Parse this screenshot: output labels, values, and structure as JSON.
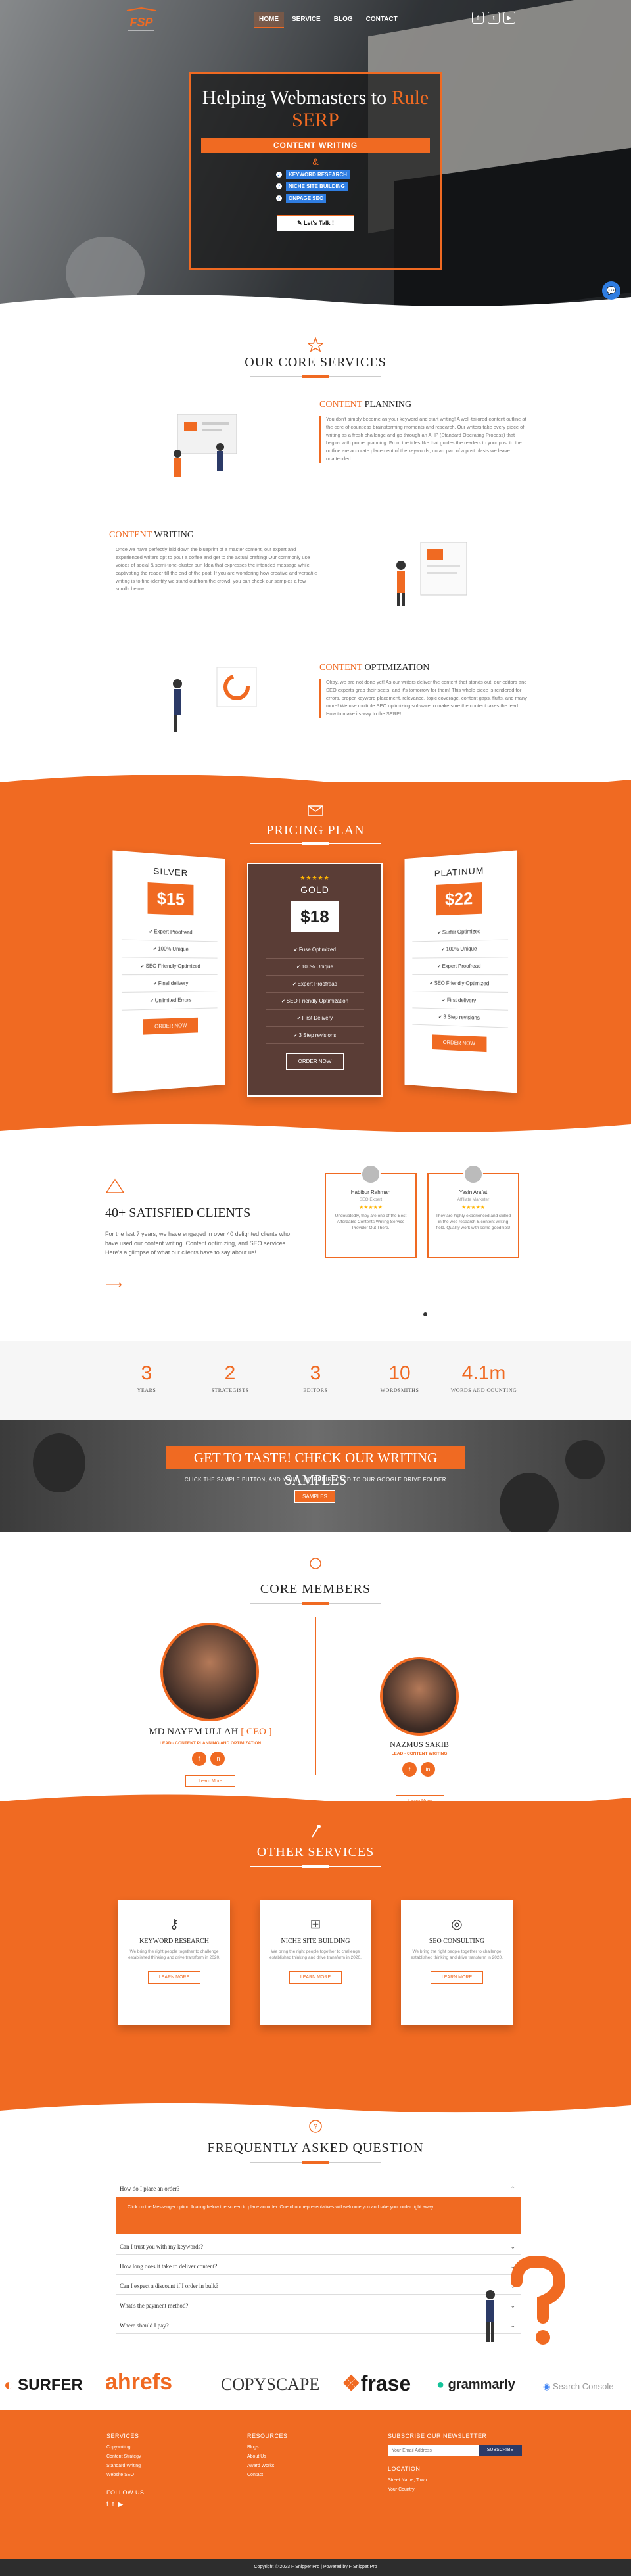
{
  "nav": {
    "logo": "FSP",
    "items": [
      "HOME",
      "SERVICE",
      "BLOG",
      "CONTACT"
    ],
    "social_icons": [
      "facebook-icon",
      "twitter-icon",
      "youtube-icon"
    ]
  },
  "hero": {
    "title_a": "Helping Webmasters to",
    "title_b": "Rule",
    "title_c": "SERP",
    "bar": "CONTENT WRITING",
    "amp": "&",
    "list": [
      "KEYWORD RESEARCH",
      "NICHE SITE BUILDING",
      "ONPAGE SEO"
    ],
    "button": "Let's Talk !"
  },
  "core": {
    "title": "OUR CORE SERVICES",
    "s1_h_o": "CONTENT",
    "s1_h": "PLANNING",
    "s1_p": "You don't simply become an your keyword and start writing! A well-tailored content outline at the core of countless brainstorming moments and research. Our writers take every piece of writing as a fresh challenge and go through an AHP (Standard Operating Process) that begins with proper planning. From the titles like that guides the readers to your post to the outline are accurate placement of the keywords, no art part of a post blasts we leave unattended.",
    "s2_h_o": "CONTENT",
    "s2_h": "WRITING",
    "s2_p": "Once we have perfectly laid down the blueprint of a master content, our expert and experienced writers opt to pour a coffee and get to the actual crafting! Our commonly use voices of social & semi-tone-cluster pun Idea that expresses the intended message while captivating the reader till the end of the post. If you are wondering how creative and versatile writing is to fine-identify we stand out from the crowd, you can check our samples a few scrolls below.",
    "s3_h_o": "CONTENT",
    "s3_h": "OPTIMIZATION",
    "s3_p": "Okay, we are not done yet! As our writers deliver the content that stands out, our editors and SEO experts grab their seats, and it's tomorrow for them! This whole piece is rendered for errors, proper keyword placement, relevance, topic coverage, content gaps, fluffs, and many more! We use multiple SEO optimizing software to make sure the content takes the lead. How to make its way to the SERP!"
  },
  "pricing": {
    "title": "PRICING PLAN",
    "plans": [
      {
        "name": "SILVER",
        "price": "$15",
        "features": [
          "Expert Proofread",
          "100% Unique",
          "SEO Friendly Optimized",
          "Final delivery",
          "Unlimited Errors"
        ],
        "button": "ORDER NOW"
      },
      {
        "name": "GOLD",
        "stars": "★★★★★",
        "price": "$18",
        "features": [
          "Fuse Optimized",
          "100% Unique",
          "Expert Proofread",
          "SEO Friendly Optimization",
          "First Delivery",
          "3 Step revisions"
        ],
        "button": "ORDER NOW"
      },
      {
        "name": "PLATINUM",
        "price": "$22",
        "features": [
          "Surfer Optimized",
          "100% Unique",
          "Expert Proofread",
          "SEO Friendly Optimized",
          "First delivery",
          "3 Step revisions"
        ],
        "button": "ORDER NOW"
      }
    ]
  },
  "clients": {
    "title_n": "40+",
    "title": "SATISFIED CLIENTS",
    "text": "For the last 7 years, we have engaged in over 40 delighted clients who have used our content writing. Content optimizing, and SEO services. Here's a glimpse of what our clients have to say about us!",
    "arrow": "⟶",
    "testimonials": [
      {
        "name": "Habibur Rahman",
        "role": "SEO Expert",
        "stars": "★★★★★",
        "text": "Undoubtedly, they are one of the Best Affordable Contents Writing Service Provider Out There."
      },
      {
        "name": "Yasin Arafat",
        "role": "Affiliate Marketer",
        "stars": "★★★★★",
        "text": "They are highly experienced and skilled in the web research & content writing field. Quality work with some good tips!"
      }
    ]
  },
  "stats": [
    {
      "n": "3",
      "l": "YEARS"
    },
    {
      "n": "2",
      "l": "STRATEGISTS"
    },
    {
      "n": "3",
      "l": "EDITORS"
    },
    {
      "n": "10",
      "l": "WORDSMITHS"
    },
    {
      "n": "4.1m",
      "l": "WORDS AND COUNTING"
    }
  ],
  "samples": {
    "title": "GET TO TASTE! CHECK OUR WRITING SAMPLES",
    "text": "CLICK THE SAMPLE BUTTON, AND YOU'LL BE REDIRECTED TO OUR GOOGLE DRIVE FOLDER",
    "button": "SAMPLES"
  },
  "members": {
    "title": "CORE MEMBERS",
    "m1_name": "MD NAYEM ULLAH",
    "m1_tag": "[ CEO ]",
    "m1_role": "LEAD - CONTENT PLANNING AND OPTIMIZATION",
    "m1_btn": "Learn More",
    "m2_name": "NAZMUS SAKIB",
    "m2_role": "LEAD - CONTENT WRITING",
    "m2_btn": "Learn More"
  },
  "other": {
    "title": "OTHER SERVICES",
    "cards": [
      {
        "icon": "key-icon",
        "title": "KEYWORD RESEARCH",
        "text": "We bring the right people together to challenge established thinking and drive transform in 2020.",
        "button": "LEARN MORE"
      },
      {
        "icon": "sitemap-icon",
        "title": "NICHE SITE BUILDING",
        "text": "We bring the right people together to challenge established thinking and drive transform in 2020.",
        "button": "LEARN MORE"
      },
      {
        "icon": "globe-icon",
        "title": "SEO CONSULTING",
        "text": "We bring the right people together to challenge established thinking and drive transform in 2020.",
        "button": "LEARN MORE"
      }
    ]
  },
  "faq": {
    "title": "FREQUENTLY ASKED QUESTION",
    "q1": "How do I place an order?",
    "a1": "Click on the Messenger option floating below the screen to place an order. One of our representatives will welcome you and take your order right away!",
    "items": [
      "Can I trust you with my keywords?",
      "How long does it take to deliver content?",
      "Can I expect a discount if I order in bulk?",
      "What's the payment method?",
      "Where should I pay?"
    ]
  },
  "logos": [
    "SURFER",
    "ahrefs",
    "COPYSCAPE",
    "frase",
    "grammarly",
    "Search Console"
  ],
  "footer": {
    "services_h": "SERVICES",
    "services": [
      "Copywriting",
      "Content Strategy",
      "Standard Writing",
      "Website SEO"
    ],
    "resources_h": "RESOURCES",
    "resources": [
      "Blogs",
      "About Us",
      "Award Works",
      "Contact"
    ],
    "newsletter_h": "SUBSCRIBE OUR NEWSLETTER",
    "newsletter_placeholder": "Your Email Address",
    "newsletter_btn": "SUBSCRIBE",
    "location_h": "LOCATION",
    "location": [
      "Street Name, Town",
      "Your Country"
    ],
    "follow_h": "FOLLOW US",
    "copyright": "Copyright © 2023 F Snipper Pro | Powered by F Snippet Pro"
  },
  "colors": {
    "accent": "#f06a22",
    "dark": "#5a3d36"
  }
}
